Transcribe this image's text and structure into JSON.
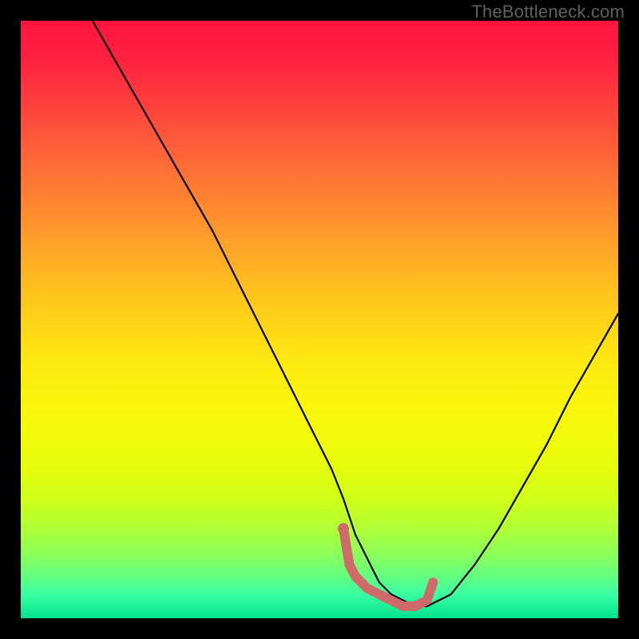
{
  "watermark": "TheBottleneck.com",
  "chart_data": {
    "type": "line",
    "title": "",
    "xlabel": "",
    "ylabel": "",
    "xlim": [
      0,
      100
    ],
    "ylim": [
      0,
      100
    ],
    "grid": false,
    "series": [
      {
        "name": "curve",
        "color": "#000000",
        "x": [
          12,
          16,
          20,
          24,
          28,
          32,
          36,
          40,
          44,
          48,
          52,
          54,
          55,
          56,
          58,
          60,
          62,
          64,
          66,
          68,
          72,
          76,
          80,
          84,
          88,
          92,
          96,
          100
        ],
        "values": [
          100,
          93,
          86,
          79,
          72,
          65,
          57,
          49,
          41,
          33,
          25,
          20,
          17,
          14,
          10,
          6,
          4,
          3,
          2,
          2,
          4,
          9,
          15,
          22,
          29,
          37,
          44,
          51
        ]
      },
      {
        "name": "highlight",
        "color": "#d46a6a",
        "x": [
          54,
          55,
          56,
          58,
          60,
          62,
          64,
          66,
          68,
          69
        ],
        "values": [
          15,
          9,
          7,
          5,
          4,
          3,
          2,
          2,
          3,
          6
        ]
      }
    ]
  },
  "gradient_stops": [
    {
      "pos": 0,
      "color": "#ff153f"
    },
    {
      "pos": 50,
      "color": "#ffd000"
    },
    {
      "pos": 75,
      "color": "#f0ff10"
    },
    {
      "pos": 100,
      "color": "#00e28c"
    }
  ]
}
